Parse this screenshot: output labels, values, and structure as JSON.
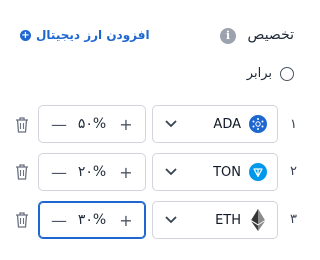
{
  "header": {
    "title": "تخصیص",
    "add_link_label": "افزودن ارز دیجیتال"
  },
  "equal_option": {
    "label": "برابر",
    "checked": false
  },
  "rows": [
    {
      "index": "۱",
      "asset": "ADA",
      "icon": "cardano-icon",
      "percent": "۵۰%",
      "icon_color": "#1e66d0"
    },
    {
      "index": "۲",
      "asset": "TON",
      "icon": "toncoin-icon",
      "percent": "۲۰%",
      "icon_color": "#0098ea"
    },
    {
      "index": "۳",
      "asset": "ETH",
      "icon": "ethereum-icon",
      "percent": "۳۰%",
      "icon_color": "#343434"
    }
  ],
  "colors": {
    "accent": "#1e66d0",
    "border": "#d1d5db"
  }
}
